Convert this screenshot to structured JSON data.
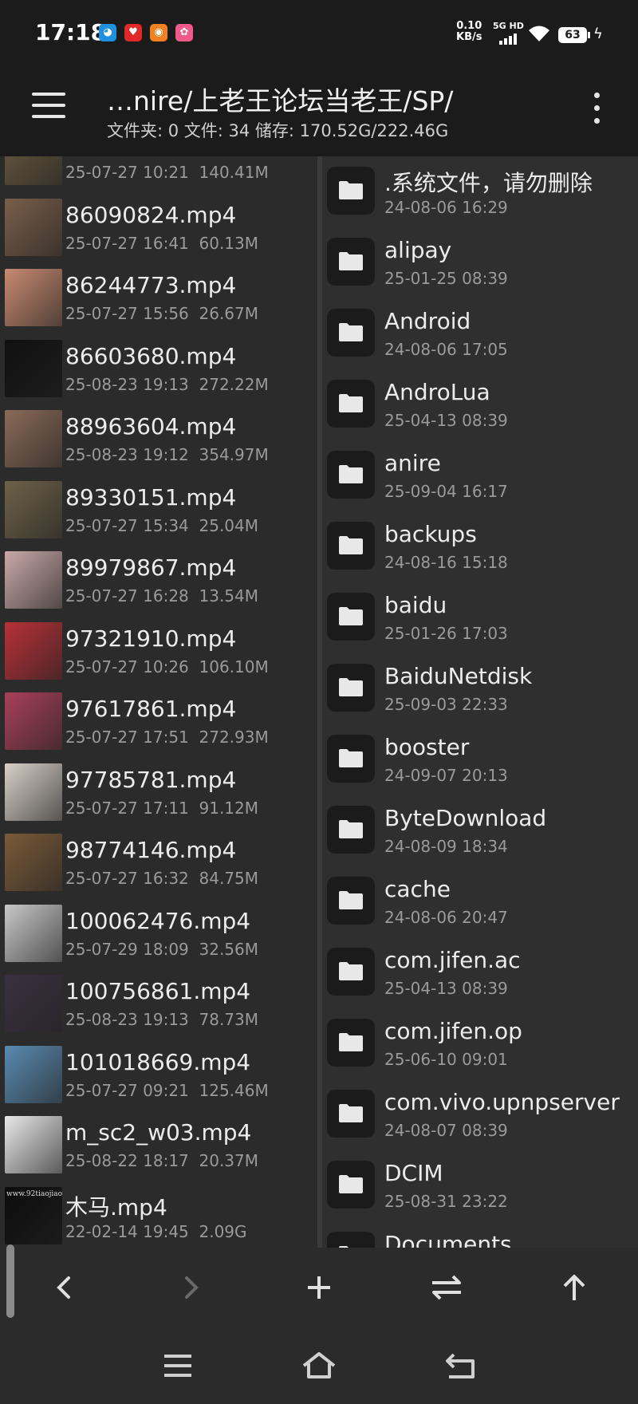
{
  "status_bar": {
    "time": "17:18",
    "net_speed_value": "0.10",
    "net_speed_unit": "KB/s",
    "network_label": "5G HD",
    "battery": "63",
    "notification_icons": [
      "qq-icon",
      "app-red-icon",
      "weibo-icon",
      "app-pink-icon"
    ]
  },
  "header": {
    "path": "…nire/上老王论坛当老王/SP/",
    "info": "文件夹: 0  文件: 34  储存: 170.52G/222.46G"
  },
  "files": [
    {
      "name": "",
      "date": "25-07-27 10:21",
      "size": "140.41M",
      "thumb": "#6b5a40"
    },
    {
      "name": "86090824.mp4",
      "date": "25-07-27 16:41",
      "size": "60.13M",
      "thumb": "#7a5e4a"
    },
    {
      "name": "86244773.mp4",
      "date": "25-07-27 15:56",
      "size": "26.67M",
      "thumb": "#c88a70"
    },
    {
      "name": "86603680.mp4",
      "date": "25-08-23 19:13",
      "size": "272.22M",
      "thumb": "#101010"
    },
    {
      "name": "88963604.mp4",
      "date": "25-08-23 19:12",
      "size": "354.97M",
      "thumb": "#8a6a58"
    },
    {
      "name": "89330151.mp4",
      "date": "25-07-27 15:34",
      "size": "25.04M",
      "thumb": "#6e6148"
    },
    {
      "name": "89979867.mp4",
      "date": "25-07-27 16:28",
      "size": "13.54M",
      "thumb": "#c9a8a8"
    },
    {
      "name": "97321910.mp4",
      "date": "25-07-27 10:26",
      "size": "106.10M",
      "thumb": "#b83038"
    },
    {
      "name": "97617861.mp4",
      "date": "25-07-27 17:51",
      "size": "272.93M",
      "thumb": "#a8405a"
    },
    {
      "name": "97785781.mp4",
      "date": "25-07-27 17:11",
      "size": "91.12M",
      "thumb": "#d8d0c8"
    },
    {
      "name": "98774146.mp4",
      "date": "25-07-27 16:32",
      "size": "84.75M",
      "thumb": "#7a5a38"
    },
    {
      "name": "100062476.mp4",
      "date": "25-07-29 18:09",
      "size": "32.56M",
      "thumb": "#c8c8c8"
    },
    {
      "name": "100756861.mp4",
      "date": "25-08-23 19:13",
      "size": "78.73M",
      "thumb": "#3a3040"
    },
    {
      "name": "101018669.mp4",
      "date": "25-07-27 09:21",
      "size": "125.46M",
      "thumb": "#5a8ab0"
    },
    {
      "name": "m_sc2_w03.mp4",
      "date": "25-08-22 18:17",
      "size": "20.37M",
      "thumb": "#e8e8e8"
    },
    {
      "name": "木马.mp4",
      "date": "22-02-14 19:45",
      "size": "2.09G",
      "thumb": "#0c0c0c"
    }
  ],
  "thumb_caption_1": "www.92tiaojiao.co",
  "folders": [
    {
      "name": ".系统文件，请勿删除",
      "date": "24-08-06 16:29"
    },
    {
      "name": "alipay",
      "date": "25-01-25 08:39"
    },
    {
      "name": "Android",
      "date": "24-08-06 17:05"
    },
    {
      "name": "AndroLua",
      "date": "25-04-13 08:39"
    },
    {
      "name": "anire",
      "date": "25-09-04 16:17"
    },
    {
      "name": "backups",
      "date": "24-08-16 15:18"
    },
    {
      "name": "baidu",
      "date": "25-01-26 17:03"
    },
    {
      "name": "BaiduNetdisk",
      "date": "25-09-03 22:33"
    },
    {
      "name": "booster",
      "date": "24-09-07 20:13"
    },
    {
      "name": "ByteDownload",
      "date": "24-08-09 18:34"
    },
    {
      "name": "cache",
      "date": "24-08-06 20:47"
    },
    {
      "name": "com.jifen.ac",
      "date": "25-04-13 08:39"
    },
    {
      "name": "com.jifen.op",
      "date": "25-06-10 09:01"
    },
    {
      "name": "com.vivo.upnpserver",
      "date": "24-08-07 08:39"
    },
    {
      "name": "DCIM",
      "date": "25-08-31 23:22"
    },
    {
      "name": "Documents",
      "date": ""
    }
  ],
  "toolbar": [
    "back-icon",
    "forward-icon",
    "add-icon",
    "swap-icon",
    "up-icon"
  ],
  "navbar": [
    "menu-icon",
    "home-icon",
    "return-icon"
  ]
}
